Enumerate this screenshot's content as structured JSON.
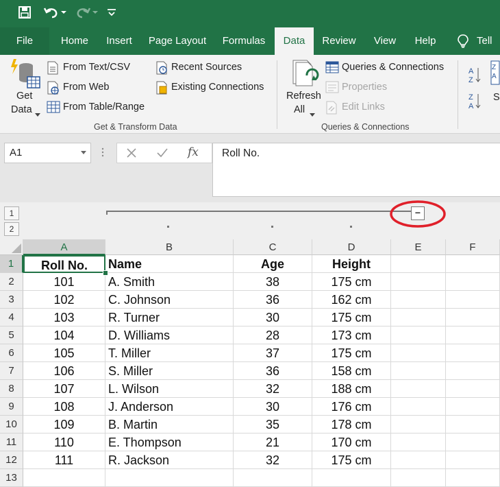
{
  "quick_access": {
    "save_icon": "save-icon",
    "undo_icon": "undo-icon",
    "redo_icon": "redo-icon",
    "customize_icon": "customize-icon"
  },
  "tabs": [
    "File",
    "Home",
    "Insert",
    "Page Layout",
    "Formulas",
    "Data",
    "Review",
    "View",
    "Help",
    "Tell"
  ],
  "active_tab": "Data",
  "ribbon": {
    "get_data_line1": "Get",
    "get_data_line2": "Data",
    "from_text_csv": "From Text/CSV",
    "from_web": "From Web",
    "from_table_range": "From Table/Range",
    "recent_sources": "Recent Sources",
    "existing_connections": "Existing Connections",
    "group1_label": "Get & Transform Data",
    "refresh_line1": "Refresh",
    "refresh_line2": "All",
    "queries_connections": "Queries & Connections",
    "properties": "Properties",
    "edit_links": "Edit Links",
    "group2_label": "Queries & Connections",
    "sort_partial": "So"
  },
  "formula_bar": {
    "name_box": "A1",
    "fx": "fx",
    "content": "Roll No."
  },
  "outline": {
    "level1": "1",
    "level2": "2",
    "collapse_button": "−",
    "highlight_color": "#e0202a"
  },
  "columns": [
    "A",
    "B",
    "C",
    "D",
    "E",
    "F"
  ],
  "selected_cell": "A1",
  "rows": [
    {
      "n": "1",
      "roll": "Roll No.",
      "name": "Name",
      "age": "Age",
      "height": "Height"
    },
    {
      "n": "2",
      "roll": "101",
      "name": "A. Smith",
      "age": "38",
      "height": "175 cm"
    },
    {
      "n": "3",
      "roll": "102",
      "name": "C. Johnson",
      "age": "36",
      "height": "162 cm"
    },
    {
      "n": "4",
      "roll": "103",
      "name": "R. Turner",
      "age": "30",
      "height": "175 cm"
    },
    {
      "n": "5",
      "roll": "104",
      "name": "D. Williams",
      "age": "28",
      "height": "173 cm"
    },
    {
      "n": "6",
      "roll": "105",
      "name": "T. Miller",
      "age": "37",
      "height": "175 cm"
    },
    {
      "n": "7",
      "roll": "106",
      "name": "S. Miller",
      "age": "36",
      "height": "158 cm"
    },
    {
      "n": "8",
      "roll": "107",
      "name": "L. Wilson",
      "age": "32",
      "height": "188 cm"
    },
    {
      "n": "9",
      "roll": "108",
      "name": "J. Anderson",
      "age": "30",
      "height": "176 cm"
    },
    {
      "n": "10",
      "roll": "109",
      "name": "B. Martin",
      "age": "35",
      "height": "178 cm"
    },
    {
      "n": "11",
      "roll": "110",
      "name": "E. Thompson",
      "age": "21",
      "height": "170 cm"
    },
    {
      "n": "12",
      "roll": "111",
      "name": "R. Jackson",
      "age": "32",
      "height": "175 cm"
    },
    {
      "n": "13",
      "roll": "",
      "name": "",
      "age": "",
      "height": ""
    }
  ],
  "colors": {
    "excel_green": "#217346",
    "ribbon_bg": "#f3f3f3"
  }
}
